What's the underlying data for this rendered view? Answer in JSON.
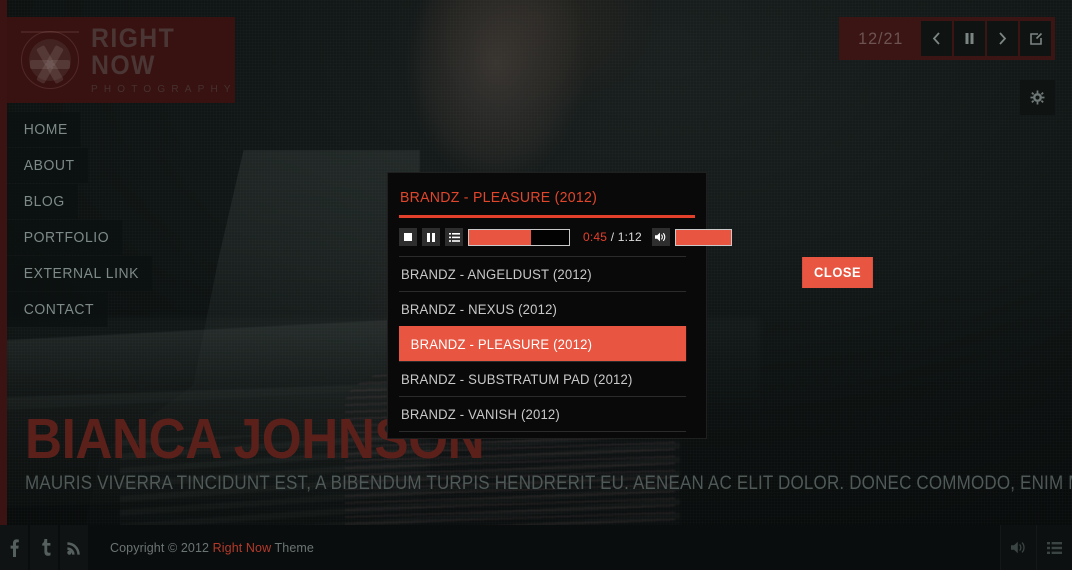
{
  "site": {
    "logo_main": "RIGHT NOW",
    "logo_sub": "PHOTOGRAPHY",
    "logo_icon": "camera-aperture-icon"
  },
  "nav": {
    "items": [
      {
        "label": "HOME"
      },
      {
        "label": "ABOUT"
      },
      {
        "label": "BLOG"
      },
      {
        "label": "PORTFOLIO"
      },
      {
        "label": "EXTERNAL LINK"
      },
      {
        "label": "CONTACT"
      }
    ]
  },
  "slideshow": {
    "counter": "12/21",
    "buttons": [
      {
        "name": "prev-slide-button",
        "icon": "chevron-left-icon"
      },
      {
        "name": "pause-slideshow-button",
        "icon": "pause-icon"
      },
      {
        "name": "next-slide-button",
        "icon": "chevron-right-icon"
      },
      {
        "name": "fullscreen-button",
        "icon": "expand-icon"
      }
    ],
    "settings_icon": "gear-icon"
  },
  "close_button": {
    "label": "CLOSE"
  },
  "player": {
    "title": "BRANDZ - PLEASURE (2012)",
    "controls": [
      {
        "name": "stop-button",
        "icon": "stop-icon"
      },
      {
        "name": "pause-button",
        "icon": "pause-icon"
      },
      {
        "name": "playlist-toggle-button",
        "icon": "list-icon"
      }
    ],
    "progress_percent": 62,
    "time_current": "0:45",
    "time_separator": " / ",
    "time_total": "1:12",
    "volume_icon": "speaker-icon",
    "volume_percent": 100,
    "playlist": [
      {
        "label": "BRANDZ - ANGELDUST (2012)",
        "active": false
      },
      {
        "label": "BRANDZ - NEXUS (2012)",
        "active": false
      },
      {
        "label": "BRANDZ - PLEASURE (2012)",
        "active": true
      },
      {
        "label": "BRANDZ - SUBSTRATUM PAD (2012)",
        "active": false
      },
      {
        "label": "BRANDZ - VANISH (2012)",
        "active": false
      }
    ]
  },
  "hero": {
    "title": "BIANCA JOHNSON",
    "subtitle": "MAURIS VIVERRA TINCIDUNT EST, A BIBENDUM TURPIS HENDRERIT EU. AENEAN AC ELIT DOLOR. DONEC COMMODO, ENIM METUS."
  },
  "footer": {
    "social": [
      {
        "name": "facebook-icon",
        "glyph": "f"
      },
      {
        "name": "twitter-icon",
        "glyph": "t"
      },
      {
        "name": "rss-icon",
        "glyph": "rss"
      }
    ],
    "copyright_prefix": "Copyright © 2012 ",
    "copyright_brand": "Right Now",
    "copyright_suffix": " Theme",
    "right_buttons": [
      {
        "name": "audio-toggle-icon",
        "icon": "speaker-icon"
      },
      {
        "name": "thumbnails-toggle-icon",
        "icon": "list-icon"
      }
    ]
  },
  "colors": {
    "accent": "#e85540",
    "accent_dark": "#e2402a",
    "logo_bg": "#381211",
    "hero_title": "#5c201b"
  }
}
